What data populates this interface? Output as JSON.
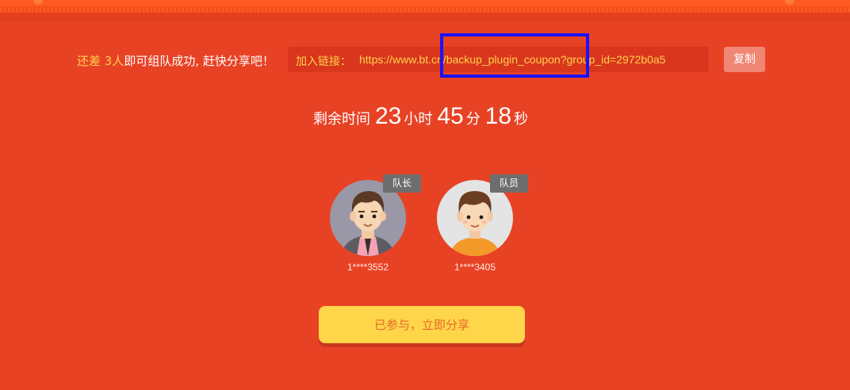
{
  "share": {
    "prefix": "还差 3人",
    "suffix": "即可组队成功, 赶快分享吧！",
    "link_label": "加入链接：",
    "link_url": "https://www.bt.cn/backup_plugin_coupon?group_id=2972b0a5",
    "copy_label": "复制"
  },
  "countdown": {
    "label": "剩余时间",
    "hours": "23",
    "hours_unit": "小时",
    "minutes": "45",
    "minutes_unit": "分",
    "seconds": "18",
    "seconds_unit": "秒"
  },
  "members": [
    {
      "role": "队长",
      "id": "1****3552"
    },
    {
      "role": "队员",
      "id": "1****3405"
    }
  ],
  "join_button": "已参与，立即分享",
  "colors": {
    "background": "#e84225",
    "accent_yellow": "#ffd24a",
    "highlight_box": "#1a12ff"
  }
}
